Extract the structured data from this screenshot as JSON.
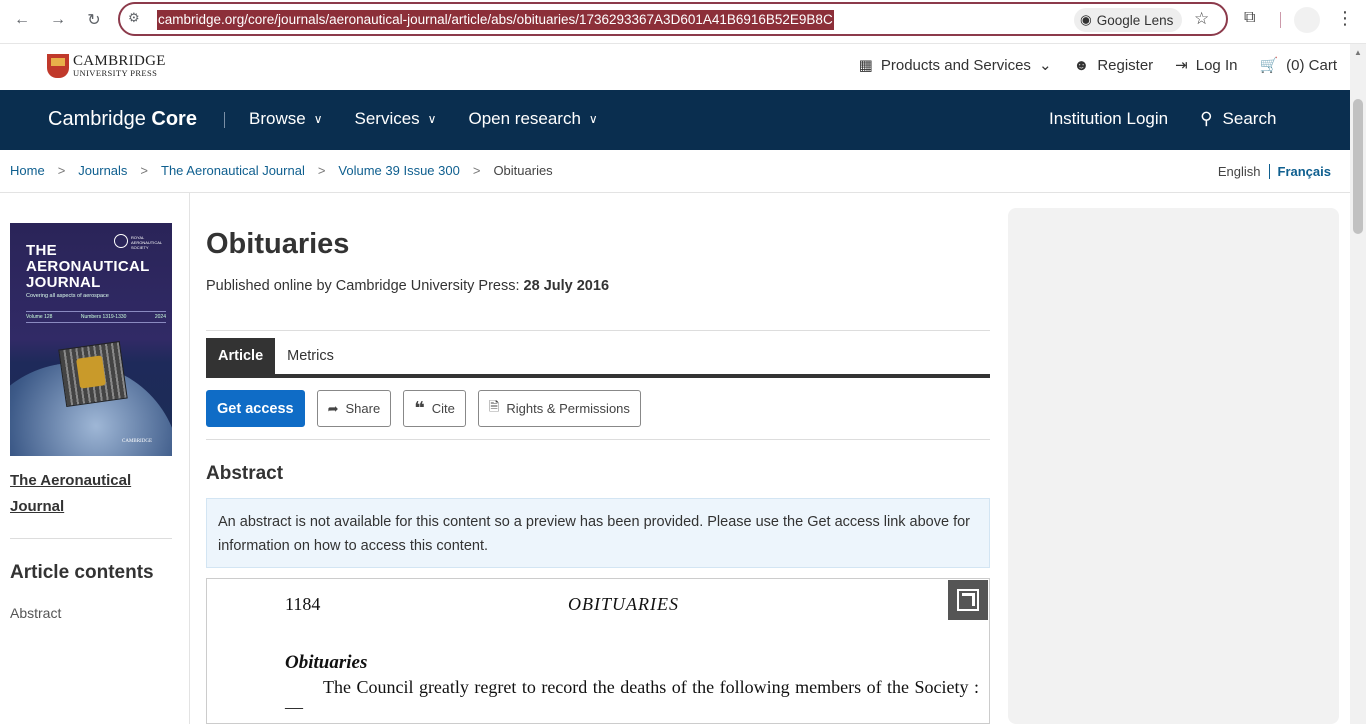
{
  "browser": {
    "url": "cambridge.org/core/journals/aeronautical-journal/article/abs/obituaries/1736293367A3D601A41B6916B52E9B8C",
    "lens_label": "Google Lens"
  },
  "publisher_bar": {
    "logo_line1": "CAMBRIDGE",
    "logo_line2": "UNIVERSITY PRESS",
    "products": "Products and Services",
    "register": "Register",
    "login": "Log In",
    "cart": "(0) Cart"
  },
  "main_nav": {
    "logo_prefix": "Cambridge",
    "logo_bold": "Core",
    "items": [
      "Browse",
      "Services",
      "Open research"
    ],
    "institution_login": "Institution Login",
    "search": "Search"
  },
  "breadcrumb": [
    "Home",
    "Journals",
    "The Aeronautical Journal",
    "Volume 39 Issue 300",
    "Obituaries"
  ],
  "languages": {
    "english": "English",
    "french": "Français"
  },
  "sidebar": {
    "cover": {
      "title_line1": "THE",
      "title_line2": "AERONAUTICAL",
      "title_line3": "JOURNAL",
      "subtitle": "Covering all aspects of aerospace",
      "volume": "Volume 128",
      "numbers": "Numbers 1319-1330",
      "year": "2024",
      "society": "ROYAL AERONAUTICAL SOCIETY",
      "publisher": "CAMBRIDGE"
    },
    "journal_link": "The Aeronautical Journal",
    "contents_heading": "Article contents",
    "contents_items": [
      "Abstract"
    ]
  },
  "article": {
    "title": "Obituaries",
    "published_prefix": "Published online by Cambridge University Press:",
    "published_date": "28 July 2016",
    "tabs": [
      "Article",
      "Metrics"
    ],
    "buttons": {
      "get_access": "Get access",
      "share": "Share",
      "cite": "Cite",
      "rights": "Rights & Permissions"
    },
    "abstract_heading": "Abstract",
    "abstract_note": "An abstract is not available for this content so a preview has been provided. Please use the Get access link above for information on how to access this content.",
    "preview": {
      "page_number": "1184",
      "running_head": "OBITUARIES",
      "title": "Obituaries",
      "body": "The Council greatly regret to record the deaths of the following members of the Society :—"
    }
  }
}
